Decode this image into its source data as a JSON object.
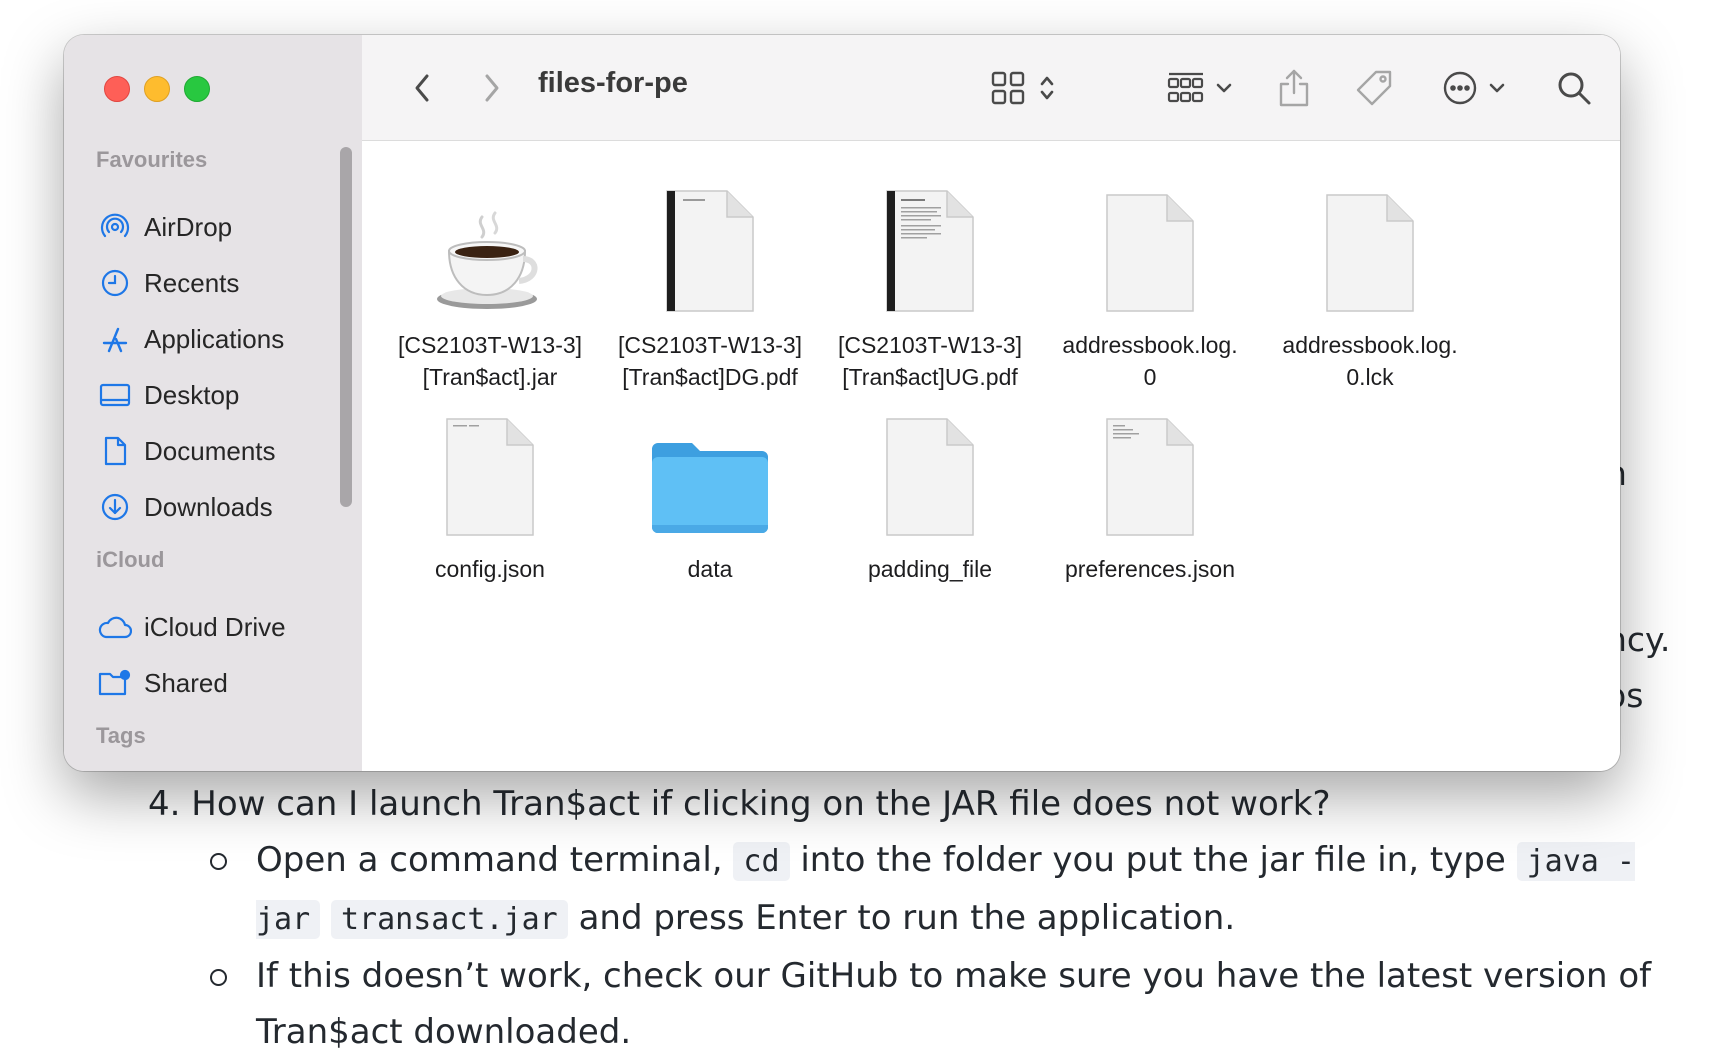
{
  "background_doc": {
    "fragments": [
      "n",
      "ncy.",
      "os"
    ],
    "faq": {
      "question": "4. How can I launch Tran$act if clicking on the JAR file does not work?",
      "bullet1": {
        "t1": "Open a command terminal,",
        "c1": "cd",
        "t2": "into the folder you put the jar file in, type",
        "c2": "java -jar",
        "c3": "transact.jar",
        "t3": "and press Enter to run the application."
      },
      "bullet2": "If this doesn’t work, check our GitHub to make sure you have the latest version of Tran$act downloaded."
    }
  },
  "finder": {
    "title": "files-for-pe",
    "sidebar": {
      "favourites_label": "Favourites",
      "favourites": [
        {
          "label": "AirDrop",
          "icon": "airdrop-icon"
        },
        {
          "label": "Recents",
          "icon": "clock-icon"
        },
        {
          "label": "Applications",
          "icon": "applications-icon"
        },
        {
          "label": "Desktop",
          "icon": "desktop-icon"
        },
        {
          "label": "Documents",
          "icon": "document-icon"
        },
        {
          "label": "Downloads",
          "icon": "download-icon"
        }
      ],
      "icloud_label": "iCloud",
      "icloud": [
        {
          "label": "iCloud Drive",
          "icon": "cloud-icon"
        },
        {
          "label": "Shared",
          "icon": "shared-folder-icon"
        }
      ],
      "tags_label": "Tags"
    },
    "files": [
      {
        "line1": "[CS2103T-W13-3]",
        "line2": "[Tran$act].jar",
        "kind": "jar"
      },
      {
        "line1": "[CS2103T-W13-3]",
        "line2": "[Tran$act]DG.pdf",
        "kind": "pdf"
      },
      {
        "line1": "[CS2103T-W13-3]",
        "line2": "[Tran$act]UG.pdf",
        "kind": "pdf"
      },
      {
        "line1": "addressbook.log.",
        "line2": "0",
        "kind": "blank"
      },
      {
        "line1": "addressbook.log.",
        "line2": "0.lck",
        "kind": "blank"
      },
      {
        "line1": "config.json",
        "line2": "",
        "kind": "text"
      },
      {
        "line1": "data",
        "line2": "",
        "kind": "folder"
      },
      {
        "line1": "padding_file",
        "line2": "",
        "kind": "blank"
      },
      {
        "line1": "preferences.json",
        "line2": "",
        "kind": "text"
      }
    ],
    "colors": {
      "accent": "#1e77e7",
      "folder": "#5fb8f2",
      "sidebar": "#e6e3e6"
    }
  }
}
